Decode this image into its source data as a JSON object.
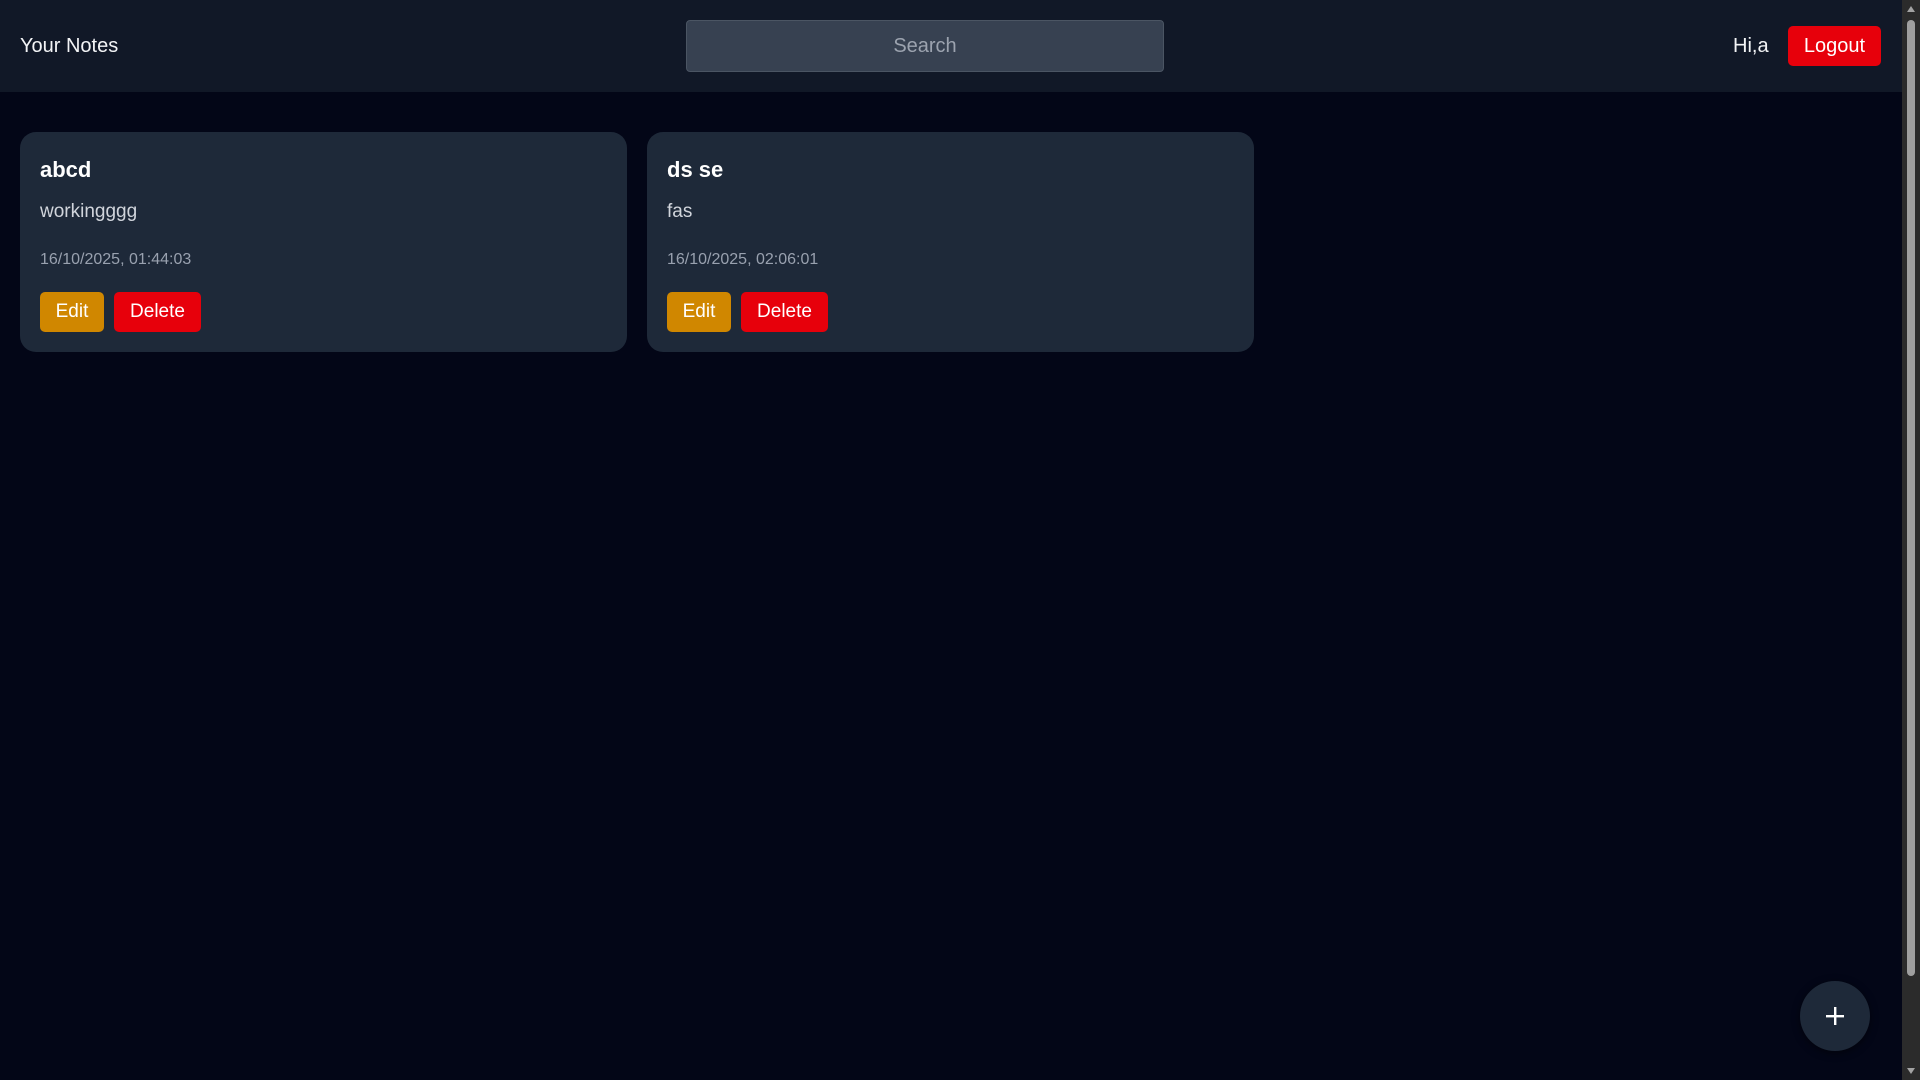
{
  "header": {
    "app_title": "Your Notes",
    "search_placeholder": "Search",
    "search_value": "",
    "greeting": "Hi,a",
    "logout_label": "Logout"
  },
  "notes": [
    {
      "title": "abcd",
      "body": "workingggg",
      "date": "16/10/2025, 01:44:03",
      "edit_label": "Edit",
      "delete_label": "Delete"
    },
    {
      "title": "ds se",
      "body": "fas",
      "date": "16/10/2025, 02:06:01",
      "edit_label": "Edit",
      "delete_label": "Delete"
    }
  ],
  "fab": {
    "icon": "plus-icon"
  },
  "colors": {
    "page_background": "#030617",
    "header_background": "#111827",
    "card_background": "#1e2939",
    "search_background": "#374151",
    "edit_button": "#d08700",
    "delete_button": "#e7000b",
    "logout_button": "#e7000b"
  }
}
